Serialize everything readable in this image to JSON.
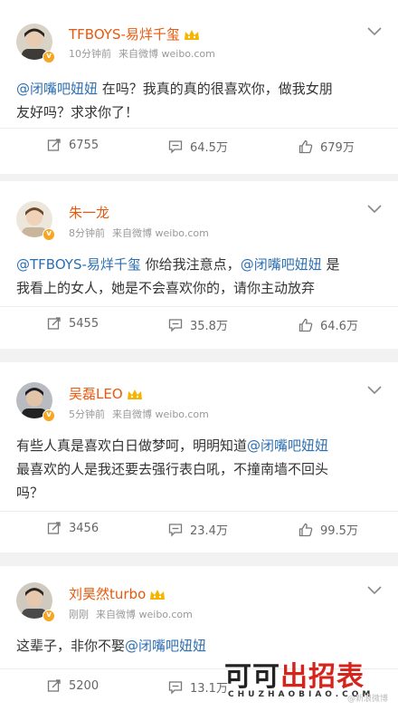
{
  "posts": [
    {
      "username": "TFBOYS-易烊千玺",
      "time": "10分钟前",
      "source": "来自微博 weibo.com",
      "content": [
        {
          "type": "mention",
          "text": "@闭嘴吧妞妞"
        },
        {
          "type": "text",
          "text": " 在吗？我真的真的很喜欢你，做我女朋"
        },
        {
          "type": "text",
          "text": "友好吗？求求你了！"
        }
      ],
      "repost_count": "6755",
      "comment_count": "64.5万",
      "like_count": "679万"
    },
    {
      "username": "朱一龙",
      "time": "8分钟前",
      "source": "来自微博 weibo.com",
      "content": [
        {
          "type": "mention",
          "text": "@TFBOYS-易烊千玺"
        },
        {
          "type": "text",
          "text": " 你给我注意点，"
        },
        {
          "type": "mention",
          "text": "@闭嘴吧妞妞"
        },
        {
          "type": "text",
          "text": " 是"
        },
        {
          "type": "text",
          "text": "我看上的女人，她是不会喜欢你的，请你主动放弃"
        }
      ],
      "repost_count": "5455",
      "comment_count": "35.8万",
      "like_count": "64.6万"
    },
    {
      "username": "吴磊LEO",
      "time": "5分钟前",
      "source": "来自微博 weibo.com",
      "content": [
        {
          "type": "text",
          "text": "有些人真是喜欢白日做梦呵，明明知道"
        },
        {
          "type": "mention",
          "text": "@闭嘴吧妞妞"
        },
        {
          "type": "text",
          "text": "最喜欢的人是我还要去强行表白吼，不撞南墙不回头"
        },
        {
          "type": "text",
          "text": "吗？"
        }
      ],
      "repost_count": "3456",
      "comment_count": "23.4万",
      "like_count": "99.5万"
    },
    {
      "username": "刘昊然turbo",
      "time": "刚刚",
      "source": "来自微博 weibo.com",
      "content": [
        {
          "type": "text",
          "text": "这辈子，非你不娶"
        },
        {
          "type": "mention",
          "text": "@闭嘴吧妞妞"
        }
      ],
      "repost_count": "5200",
      "comment_count": "13.1万",
      "like_count": ""
    }
  ],
  "watermark": {
    "black_text": "可可",
    "red_text": "出招表",
    "sub_text": "CHUZHAOBIAO.COM",
    "tag": "@新浪微博"
  },
  "colors": {
    "username": "#e8590c",
    "mention": "#2d6fb0",
    "verified_badge": "#f5a623",
    "watermark_red": "#d6231b"
  },
  "icons": {
    "repost": "repost-icon",
    "comment": "comment-icon",
    "like": "like-icon",
    "menu": "chevron-down-icon",
    "member": "crown-icon",
    "verified": "verified-v-icon"
  }
}
